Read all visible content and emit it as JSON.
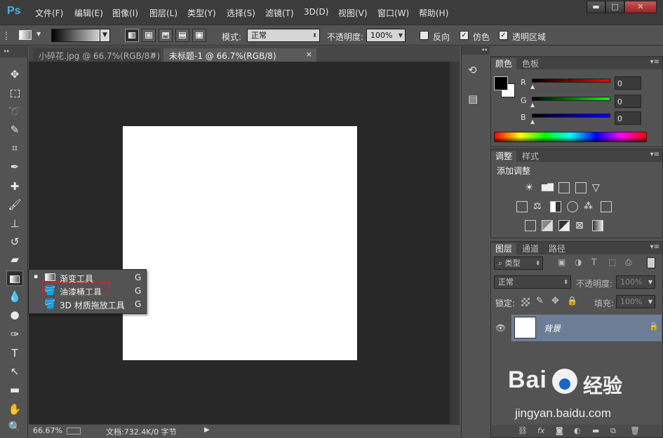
{
  "app": {
    "logo": "Ps"
  },
  "menu": [
    "文件(F)",
    "编辑(E)",
    "图像(I)",
    "图层(L)",
    "类型(Y)",
    "选择(S)",
    "滤镜(T)",
    "3D(D)",
    "视图(V)",
    "窗口(W)",
    "帮助(H)"
  ],
  "window_controls": {
    "minimize": "▬",
    "maximize": "□",
    "close": "✕"
  },
  "options": {
    "mode_label": "模式:",
    "mode_value": "正常",
    "opacity_label": "不透明度:",
    "opacity_value": "100%",
    "reverse_label": "反向",
    "reverse_checked": false,
    "dither_label": "仿色",
    "dither_checked": true,
    "transparency_label": "透明区域",
    "transparency_checked": true
  },
  "tabs": [
    {
      "label": "小碎花.jpg @ 66.7%(RGB/8#)",
      "close": "×",
      "active": false
    },
    {
      "label": "未标题-1 @ 66.7%(RGB/8)",
      "close": "×",
      "active": true
    }
  ],
  "tool_flyout": [
    {
      "label": "渐变工具",
      "key": "G",
      "current": true,
      "marker": "▪"
    },
    {
      "label": "油漆桶工具",
      "key": "G",
      "current": false,
      "marker": ""
    },
    {
      "label": "3D 材质拖放工具",
      "key": "G",
      "current": false,
      "marker": ""
    }
  ],
  "status": {
    "zoom": "66.67%",
    "doc_info": "文档:732.4K/0 字节",
    "arrow": "▶"
  },
  "color_panel": {
    "tabs": [
      "颜色",
      "色板"
    ],
    "channels": [
      {
        "name": "R",
        "value": "0",
        "color": "#ff0000"
      },
      {
        "name": "G",
        "value": "0",
        "color": "#00ff00"
      },
      {
        "name": "B",
        "value": "0",
        "color": "#0000ff"
      }
    ],
    "foreground": "#000000",
    "background": "#ffffff"
  },
  "adjust_panel": {
    "tabs": [
      "调整",
      "样式"
    ],
    "title": "添加调整"
  },
  "layers_panel": {
    "tabs": [
      "图层",
      "通道",
      "路径"
    ],
    "filter_label": "类型",
    "blend_mode": "正常",
    "opacity_label": "不透明度:",
    "opacity_value": "100%",
    "lock_label": "锁定:",
    "fill_label": "填充:",
    "fill_value": "100%",
    "layers": [
      {
        "name": "背景",
        "locked": true,
        "visible": true
      }
    ]
  },
  "watermark": {
    "brand": "Bai",
    "brand2": "经验",
    "url": "jingyan.baidu.com"
  }
}
